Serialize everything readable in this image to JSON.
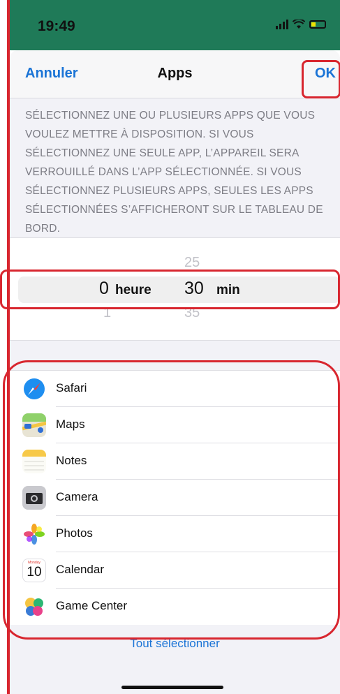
{
  "status": {
    "time": "19:49"
  },
  "nav": {
    "cancel": "Annuler",
    "title": "Apps",
    "ok": "OK"
  },
  "description": "SÉLECTIONNEZ UNE OU PLUSIEURS APPS QUE VOUS VOULEZ METTRE À DISPOSITION. SI VOUS SÉLECTIONNEZ UNE SEULE APP, L’APPAREIL SERA VERROUILLÉ DANS L’APP SÉLECTIONNÉE. SI VOUS SÉLECTIONNEZ PLUSIEURS APPS, SEULES LES APPS SÉLECTIONNÉES S’AFFICHERONT SUR LE TABLEAU DE BORD.",
  "picker": {
    "hour_value": "0",
    "hour_label": "heure",
    "hour_below": "1",
    "min_above": "25",
    "min_value": "30",
    "min_label": "min",
    "min_below": "35"
  },
  "apps": [
    {
      "name": "Safari",
      "icon": "safari-icon"
    },
    {
      "name": "Maps",
      "icon": "maps-icon"
    },
    {
      "name": "Notes",
      "icon": "notes-icon"
    },
    {
      "name": "Camera",
      "icon": "camera-icon"
    },
    {
      "name": "Photos",
      "icon": "photos-icon"
    },
    {
      "name": "Calendar",
      "icon": "calendar-icon",
      "icon_text": "10",
      "icon_sub": "Monday"
    },
    {
      "name": "Game Center",
      "icon": "game-center-icon"
    }
  ],
  "select_all": "Tout sélectionner",
  "colors": {
    "accent": "#1b74d6",
    "status_bar": "#1f7a58",
    "annotation": "#d8262f"
  }
}
